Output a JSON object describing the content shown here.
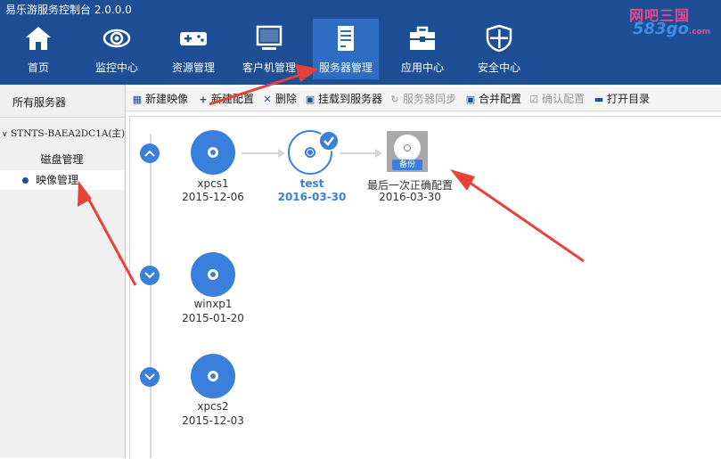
{
  "app": {
    "title": "易乐游服务控制台 2.0.0.0"
  },
  "watermark": {
    "top": "网吧三国",
    "bottom": "583go",
    "suffix": ".com"
  },
  "nav": {
    "items": [
      {
        "label": "首页",
        "icon": "home-icon"
      },
      {
        "label": "监控中心",
        "icon": "eye-icon"
      },
      {
        "label": "资源管理",
        "icon": "gamepad-icon"
      },
      {
        "label": "客户机管理",
        "icon": "monitor-icon"
      },
      {
        "label": "服务器管理",
        "icon": "server-document-icon",
        "active": true
      },
      {
        "label": "应用中心",
        "icon": "toolbox-icon"
      },
      {
        "label": "安全中心",
        "icon": "shield-icon"
      }
    ]
  },
  "sidebar": {
    "all_servers": "所有服务器",
    "server_name": "STNTS-BAEA2DC1A(主)",
    "disk_management": "磁盘管理",
    "image_management": "映像管理"
  },
  "toolbar": {
    "new_image": "新建映像",
    "new_config": "新建配置",
    "delete": "删除",
    "mount_to_server": "挂载到服务器",
    "server_sync": "服务器同步",
    "merge_config": "合并配置",
    "confirm_config": "确认配置",
    "open_dir": "打开目录"
  },
  "images": [
    {
      "nodes": [
        {
          "name": "xpcs1",
          "date": "2015-12-06"
        },
        {
          "name": "test",
          "date": "2016-03-30",
          "current": true
        },
        {
          "name": "最后一次正确配置",
          "date": "2016-03-30",
          "badge": "备份"
        }
      ]
    },
    {
      "nodes": [
        {
          "name": "winxp1",
          "date": "2015-01-20"
        }
      ]
    },
    {
      "nodes": [
        {
          "name": "xpcs2",
          "date": "2015-12-03"
        }
      ]
    }
  ],
  "colors": {
    "header": "#1e4f96",
    "accent": "#3a7fdc",
    "annotation": "#e8413a"
  }
}
